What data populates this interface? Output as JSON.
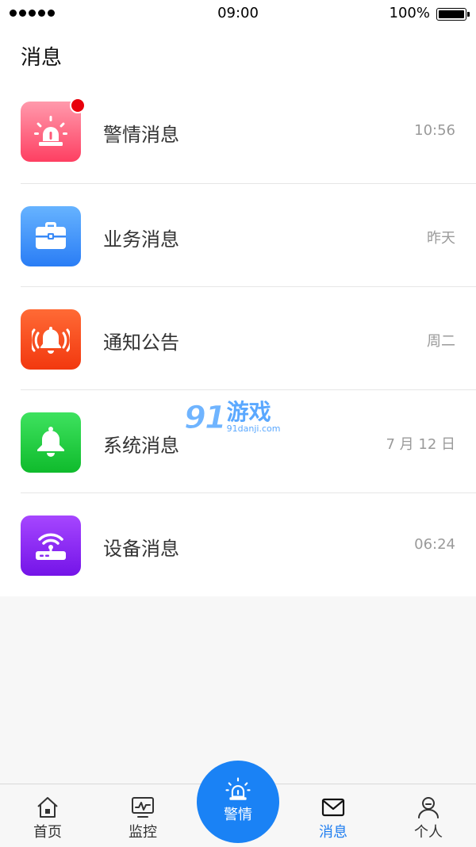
{
  "status_bar": {
    "time": "09:00",
    "battery": "100%"
  },
  "header": {
    "title": "消息"
  },
  "messages": [
    {
      "label": "警情消息",
      "time": "10:56",
      "icon": "alarm-siren-icon",
      "color": "#fe3f62",
      "unread": true
    },
    {
      "label": "业务消息",
      "time": "昨天",
      "icon": "briefcase-icon",
      "color": "#2a7df5",
      "unread": false
    },
    {
      "label": "通知公告",
      "time": "周二",
      "icon": "ringing-bell-icon",
      "color": "#f2380f",
      "unread": false
    },
    {
      "label": "系统消息",
      "time": "7 月 12 日",
      "icon": "bell-icon",
      "color": "#0fbb2c",
      "unread": false
    },
    {
      "label": "设备消息",
      "time": "06:24",
      "icon": "router-icon",
      "color": "#7414e8",
      "unread": false
    }
  ],
  "watermark": {
    "number": "91",
    "name": "游戏",
    "url": "91danji.com"
  },
  "tabbar": {
    "home": "首页",
    "monitor": "监控",
    "alarm": "警情",
    "message": "消息",
    "profile": "个人",
    "active_color": "#1f7ef0"
  }
}
